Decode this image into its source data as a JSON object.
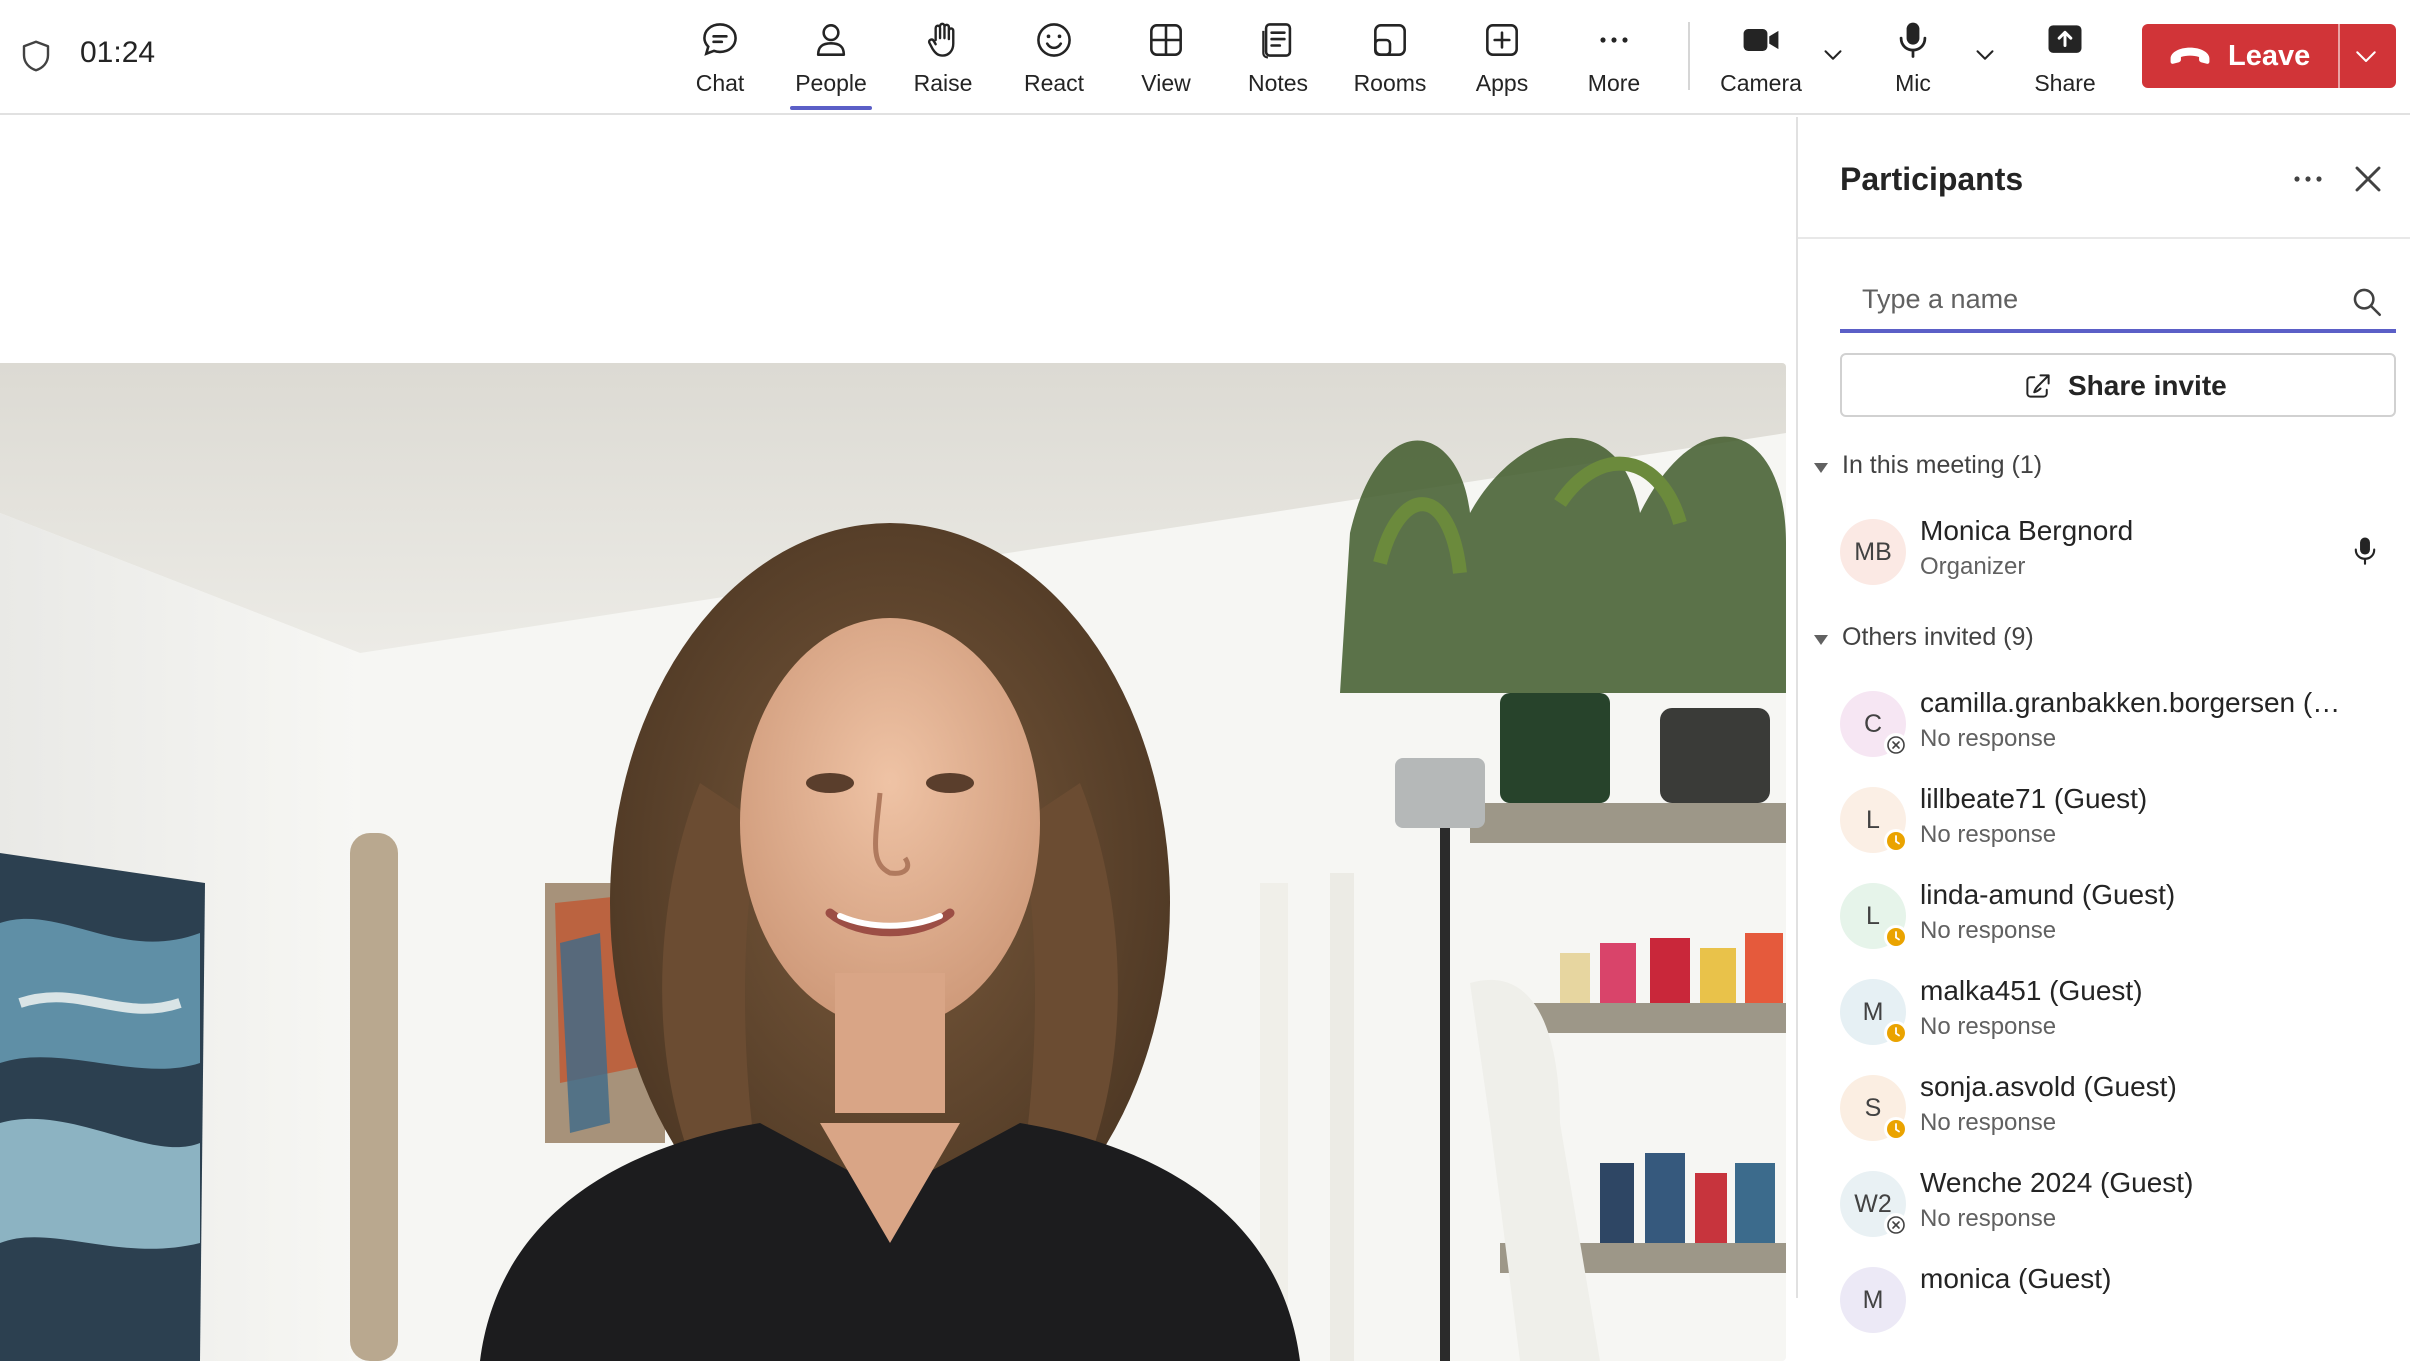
{
  "header": {
    "timer": "01:24",
    "tools": [
      {
        "label": "Chat",
        "icon": "chat-icon"
      },
      {
        "label": "People",
        "icon": "people-icon",
        "active": true
      },
      {
        "label": "Raise",
        "icon": "raise-hand-icon"
      },
      {
        "label": "React",
        "icon": "react-smiley-icon"
      },
      {
        "label": "View",
        "icon": "view-grid-icon"
      },
      {
        "label": "Notes",
        "icon": "notes-icon"
      },
      {
        "label": "Rooms",
        "icon": "rooms-icon"
      },
      {
        "label": "Apps",
        "icon": "apps-add-icon"
      },
      {
        "label": "More",
        "icon": "more-dots-icon"
      },
      {
        "label": "Camera",
        "icon": "camera-icon"
      },
      {
        "label": "Mic",
        "icon": "mic-icon"
      },
      {
        "label": "Share",
        "icon": "share-tray-icon"
      }
    ],
    "leave_label": "Leave"
  },
  "colors": {
    "accent": "#5b5fc7",
    "leave": "#d13438",
    "away_status": "#eaa300"
  },
  "panel": {
    "title": "Participants",
    "search_placeholder": "Type a name",
    "share_invite": "Share invite",
    "in_meeting": {
      "label": "In this meeting (1)",
      "people": [
        {
          "initials": "MB",
          "name": "Monica Bergnord",
          "sub": "Organizer",
          "avatar_bg": "#fbe9e4"
        }
      ]
    },
    "others": {
      "label": "Others invited (9)",
      "people": [
        {
          "initials": "C",
          "name": "camilla.granbakken.borgersen (…",
          "sub": "No response",
          "avatar_bg": "#f6e6f3",
          "status": "declined"
        },
        {
          "initials": "L",
          "name": "lillbeate71 (Guest)",
          "sub": "No response",
          "avatar_bg": "#fbefe5",
          "status": "away"
        },
        {
          "initials": "L",
          "name": "linda-amund (Guest)",
          "sub": "No response",
          "avatar_bg": "#e6f4ea",
          "status": "away"
        },
        {
          "initials": "M",
          "name": "malka451 (Guest)",
          "sub": "No response",
          "avatar_bg": "#e6f0f4",
          "status": "away"
        },
        {
          "initials": "S",
          "name": "sonja.asvold (Guest)",
          "sub": "No response",
          "avatar_bg": "#fbeee2",
          "status": "away"
        },
        {
          "initials": "W2",
          "name": "Wenche 2024 (Guest)",
          "sub": "No response",
          "avatar_bg": "#e9f1f4",
          "status": "declined"
        },
        {
          "initials": "M",
          "name": "monica (Guest)",
          "sub": "",
          "avatar_bg": "#ece9f6",
          "status": ""
        }
      ]
    }
  }
}
